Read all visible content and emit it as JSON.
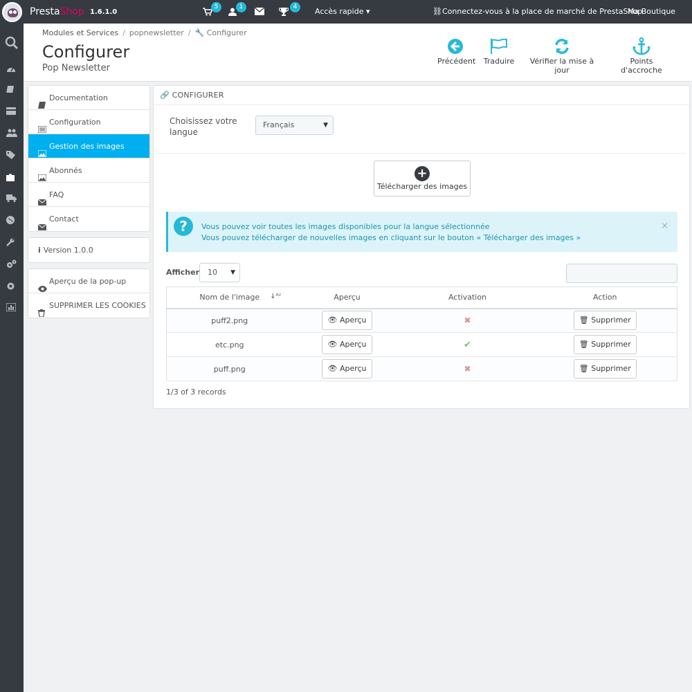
{
  "topbar": {
    "brand_part1": "Presta",
    "brand_part2": "Shop",
    "version": "1.6.1.0",
    "badges": {
      "orders": "5",
      "customers": "1",
      "messages": "",
      "trophy": "4"
    },
    "quick_access": "Accès rapide",
    "marketplace": "Connectez-vous à la place de marché de PrestaShop",
    "shop_name": "Ma Boutique"
  },
  "breadcrumb": [
    "Modules et Services",
    "popnewsletter",
    "Configurer"
  ],
  "header": {
    "title": "Configurer",
    "subtitle": "Pop Newsletter"
  },
  "toolbar": [
    {
      "label": "Précédent",
      "icon": "back-circle-icon"
    },
    {
      "label": "Traduire",
      "icon": "flag-icon"
    },
    {
      "label": "Vérifier la mise à jour",
      "icon": "refresh-icon"
    },
    {
      "label": "Points d'accroche",
      "icon": "anchor-icon"
    }
  ],
  "side_menu": {
    "group1": [
      {
        "label": "Documentation",
        "icon": "book-icon"
      },
      {
        "label": "Configuration",
        "icon": "list-icon"
      },
      {
        "label": "Gestion des images",
        "icon": "image-icon",
        "active": true
      },
      {
        "label": "Abonnés",
        "icon": "image-icon"
      },
      {
        "label": "FAQ",
        "icon": "envelope-icon"
      },
      {
        "label": "Contact",
        "icon": "envelope-icon"
      }
    ],
    "version": "Version 1.0.0",
    "group3": [
      {
        "label": "Aperçu de la pop-up",
        "icon": "eye-icon"
      },
      {
        "label": "SUPPRIMER LES COOKIES",
        "icon": "trash-icon"
      }
    ]
  },
  "panel": {
    "heading": "CONFIGURER",
    "language_label": "Choisissez votre langue",
    "language_value": "Français",
    "upload_label": "Télécharger des images",
    "info_line1": "Vous pouvez voir toutes les images disponibles pour la langue sélectionnée",
    "info_line2": "Vous pouvez télécharger de nouvelles images en cliquant sur le bouton « Télécharger des images »",
    "info_close": "×",
    "show_label": "Afficher",
    "per_page": "10",
    "columns": [
      "Nom de l'image",
      "Aperçu",
      "Activation",
      "Action"
    ],
    "rows": [
      {
        "name": "puff2.png",
        "preview": "Aperçu",
        "active": false,
        "action": "Supprimer"
      },
      {
        "name": "etc.png",
        "preview": "Aperçu",
        "active": true,
        "action": "Supprimer"
      },
      {
        "name": "puff.png",
        "preview": "Aperçu",
        "active": false,
        "action": "Supprimer"
      }
    ],
    "records": "1/3 of 3 records"
  },
  "colors": {
    "topbar_bg": "#363a41",
    "accent": "#00aff0",
    "info_bg": "#dcf4f9",
    "info_text": "#1e94ab",
    "brand_pink": "#df0067"
  }
}
